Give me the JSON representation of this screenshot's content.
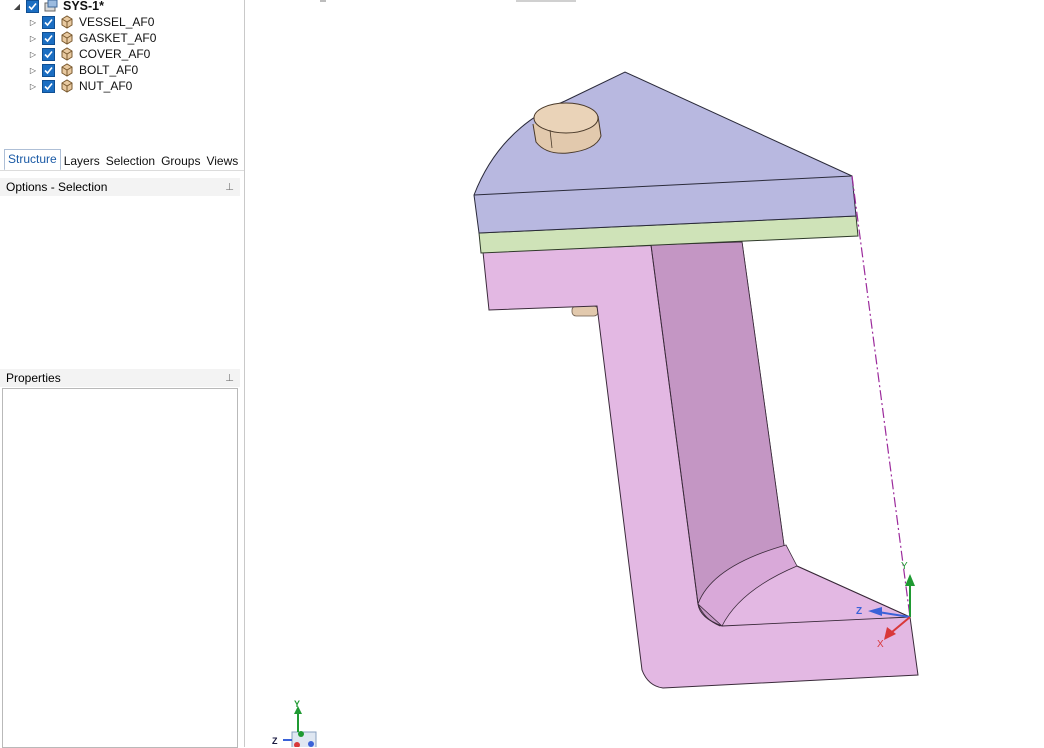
{
  "tree": {
    "root": {
      "label": "SYS-1*",
      "checked": true,
      "icon": "assembly-icon"
    },
    "items": [
      {
        "label": "VESSEL_AF0",
        "checked": true,
        "icon": "part-icon"
      },
      {
        "label": "GASKET_AF0",
        "checked": true,
        "icon": "part-icon"
      },
      {
        "label": "COVER_AF0",
        "checked": true,
        "icon": "part-icon"
      },
      {
        "label": "BOLT_AF0",
        "checked": true,
        "icon": "part-icon"
      },
      {
        "label": "NUT_AF0",
        "checked": true,
        "icon": "part-icon"
      }
    ]
  },
  "tabs": [
    {
      "label": "Structure",
      "active": true
    },
    {
      "label": "Layers",
      "active": false
    },
    {
      "label": "Selection",
      "active": false
    },
    {
      "label": "Groups",
      "active": false
    },
    {
      "label": "Views",
      "active": false
    }
  ],
  "options_panel": {
    "title": "Options - Selection"
  },
  "properties_panel": {
    "title": "Properties"
  },
  "viewport": {
    "triad": {
      "y": "Y",
      "z": "Z",
      "x": "X"
    },
    "mini_triad": {
      "y": "Y",
      "z": "Z"
    },
    "colors": {
      "cover": "#b8b8e0",
      "gasket": "#cfe3b8",
      "vessel": "#e3b8e3",
      "bolt": "#ead3b8",
      "x_axis": "#d9383a",
      "y_axis": "#1f9a32",
      "z_axis": "#3a62d8"
    }
  }
}
